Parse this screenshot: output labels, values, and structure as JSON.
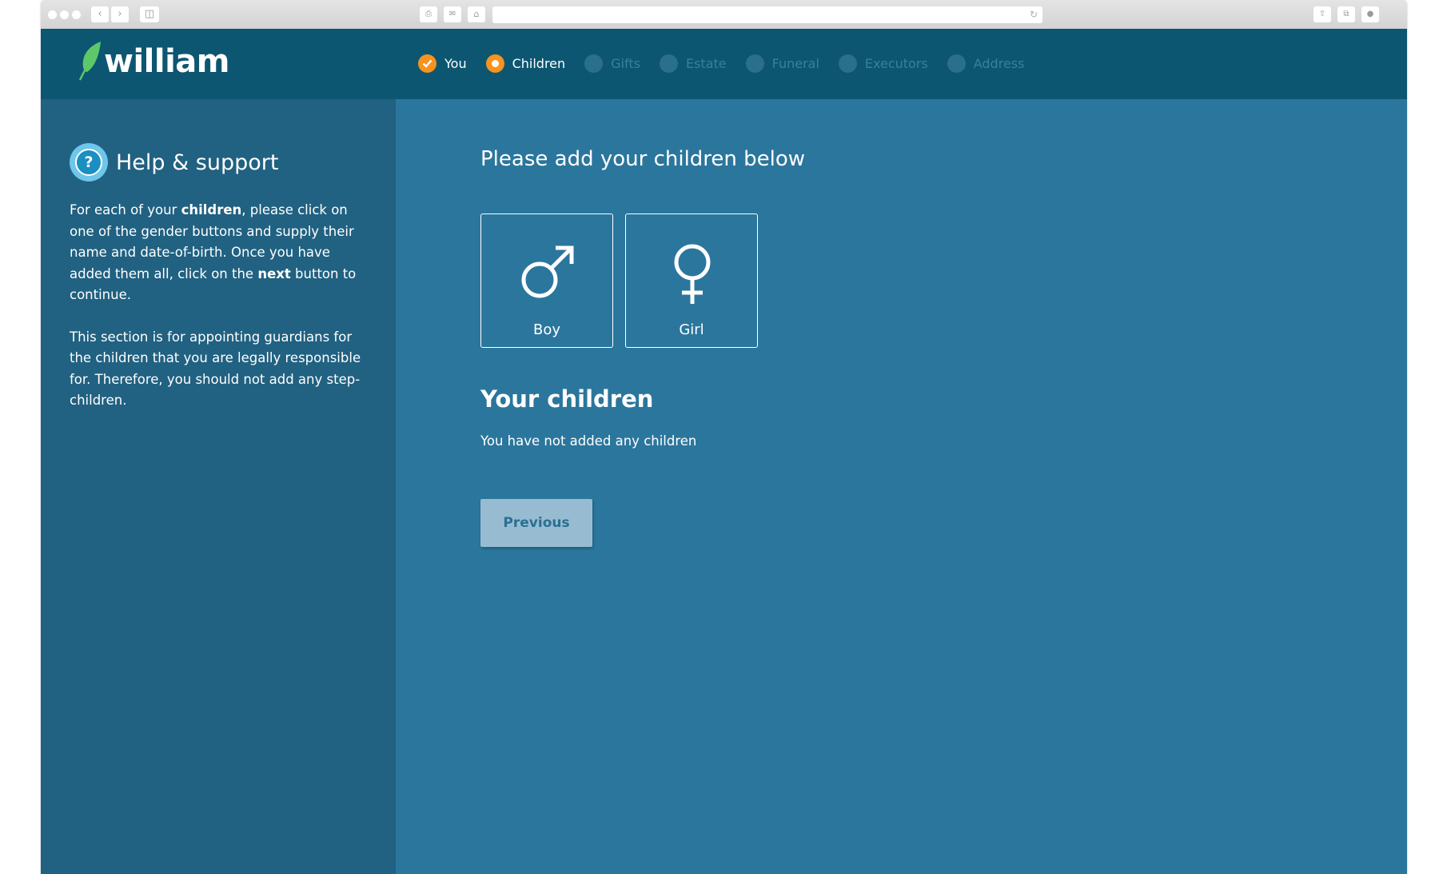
{
  "brand": {
    "name": "william",
    "accent_color": "#f7931e",
    "leaf_color": "#5cc86a",
    "nav_bg": "#0d5671",
    "sidebar_bg": "#216181",
    "main_bg": "#2b769d"
  },
  "steps": [
    {
      "label": "You",
      "status": "done"
    },
    {
      "label": "Children",
      "status": "current"
    },
    {
      "label": "Gifts",
      "status": "pending"
    },
    {
      "label": "Estate",
      "status": "pending"
    },
    {
      "label": "Funeral",
      "status": "pending"
    },
    {
      "label": "Executors",
      "status": "pending"
    },
    {
      "label": "Address",
      "status": "pending"
    }
  ],
  "help": {
    "title": "Help & support",
    "p1_a": "For each of your ",
    "p1_b": "children",
    "p1_c": ", please click on one of the gender buttons and supply their name and date-of-birth. Once you have added them all, click on the ",
    "p1_d": "next",
    "p1_e": " button to continue.",
    "p2": "This section is for appointing guardians for the children that you are legally responsible for. Therefore, you should not add any step-children."
  },
  "main": {
    "title": "Please add your children below",
    "boy_label": "Boy",
    "girl_label": "Girl",
    "children_title": "Your children",
    "no_children_text": "You have not added any children",
    "previous_label": "Previous"
  }
}
